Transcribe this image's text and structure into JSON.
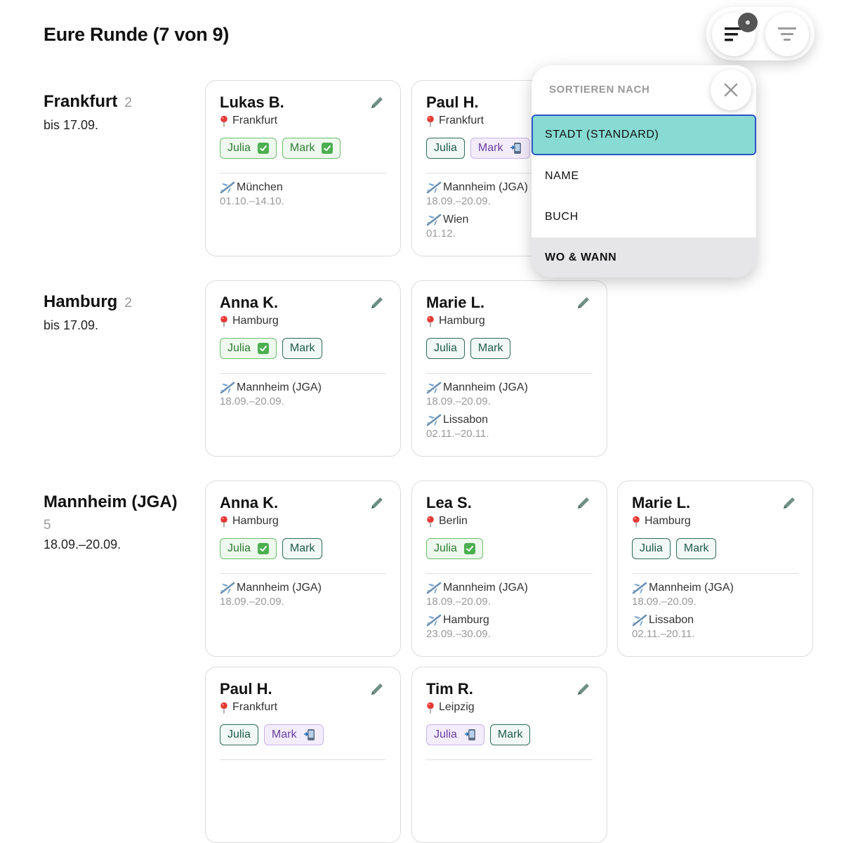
{
  "page": {
    "title": "Eure Runde (7 von 9)"
  },
  "toolbar": {
    "sort_icon": "sort-lines-icon",
    "filter_icon": "filter-lines-icon"
  },
  "colors": {
    "selected_option": "#87dbd3",
    "focus_outline": "#2b55c9",
    "hover_option": "#e6e6e8"
  },
  "groups": [
    {
      "name": "Frankfurt",
      "count": "2",
      "date": "bis 17.09."
    },
    {
      "name": "Hamburg",
      "count": "2",
      "date": "bis 17.09."
    },
    {
      "name": "Mannheim (JGA)",
      "count": "5",
      "date": "18.09.–20.09."
    }
  ],
  "cards": [
    {
      "name": "Lukas B.",
      "location": "Frankfurt",
      "tags": [
        {
          "label": "Julia",
          "status": "done"
        },
        {
          "label": "Mark",
          "status": "done"
        }
      ],
      "trips": [
        {
          "place": "München",
          "dates": "01.10.–14.10."
        }
      ]
    },
    {
      "name": "Paul H.",
      "location": "Frankfurt",
      "tags": [
        {
          "label": "Julia",
          "status": "open"
        },
        {
          "label": "Mark",
          "status": "sent"
        }
      ],
      "trips": [
        {
          "place": "Mannheim (JGA)",
          "dates": "18.09.–20.09."
        },
        {
          "place": "Wien",
          "dates": "01.12."
        }
      ]
    },
    {
      "name": "Anna K.",
      "location": "Hamburg",
      "tags": [
        {
          "label": "Julia",
          "status": "done"
        },
        {
          "label": "Mark",
          "status": "open"
        }
      ],
      "trips": [
        {
          "place": "Mannheim (JGA)",
          "dates": "18.09.–20.09."
        }
      ]
    },
    {
      "name": "Marie L.",
      "location": "Hamburg",
      "tags": [
        {
          "label": "Julia",
          "status": "open"
        },
        {
          "label": "Mark",
          "status": "open"
        }
      ],
      "trips": [
        {
          "place": "Mannheim (JGA)",
          "dates": "18.09.–20.09."
        },
        {
          "place": "Lissabon",
          "dates": "02.11.–20.11."
        }
      ]
    },
    {
      "name": "Anna K.",
      "location": "Hamburg",
      "tags": [
        {
          "label": "Julia",
          "status": "done"
        },
        {
          "label": "Mark",
          "status": "open"
        }
      ],
      "trips": [
        {
          "place": "Mannheim (JGA)",
          "dates": "18.09.–20.09."
        }
      ]
    },
    {
      "name": "Lea S.",
      "location": "Berlin",
      "tags": [
        {
          "label": "Julia",
          "status": "done"
        }
      ],
      "trips": [
        {
          "place": "Mannheim (JGA)",
          "dates": "18.09.–20.09."
        },
        {
          "place": "Hamburg",
          "dates": "23.09.–30.09."
        }
      ]
    },
    {
      "name": "Marie L.",
      "location": "Hamburg",
      "tags": [
        {
          "label": "Julia",
          "status": "open"
        },
        {
          "label": "Mark",
          "status": "open"
        }
      ],
      "trips": [
        {
          "place": "Mannheim (JGA)",
          "dates": "18.09.–20.09."
        },
        {
          "place": "Lissabon",
          "dates": "02.11.–20.11."
        }
      ]
    },
    {
      "name": "Paul H.",
      "location": "Frankfurt",
      "tags": [
        {
          "label": "Julia",
          "status": "open"
        },
        {
          "label": "Mark",
          "status": "sent"
        }
      ],
      "trips": []
    },
    {
      "name": "Tim R.",
      "location": "Leipzig",
      "tags": [
        {
          "label": "Julia",
          "status": "sent"
        },
        {
          "label": "Mark",
          "status": "open"
        }
      ],
      "trips": []
    }
  ],
  "sort_menu": {
    "heading": "SORTIEREN NACH",
    "options": [
      "STADT (STANDARD)",
      "NAME",
      "BUCH",
      "WO & WANN"
    ],
    "selected": "STADT (STANDARD)",
    "hovered": "WO & WANN"
  }
}
